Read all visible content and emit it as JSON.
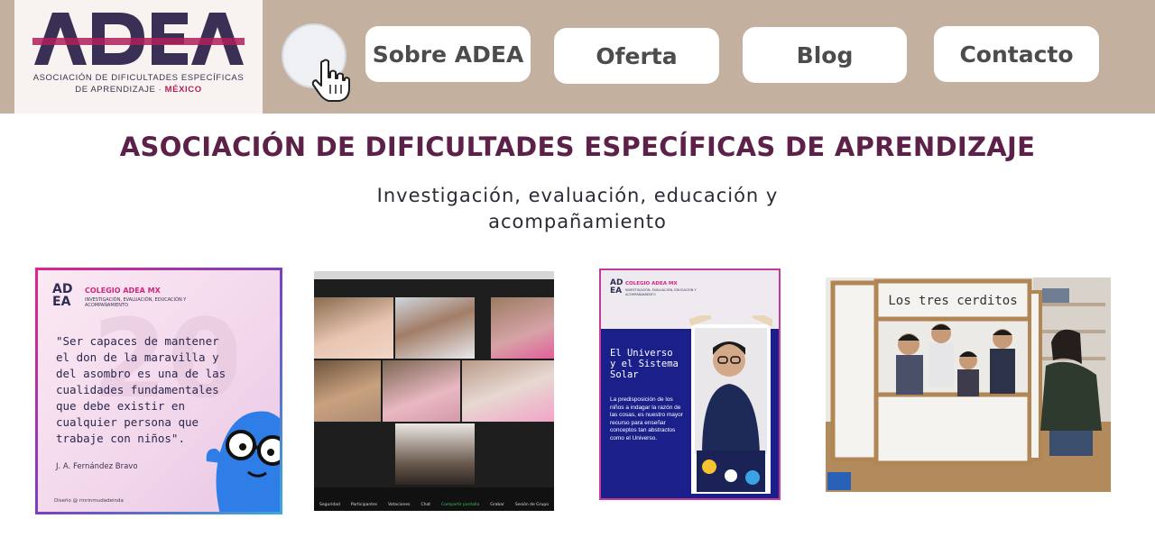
{
  "logo": {
    "wordmark": "ADEA",
    "subtitle_line1": "ASOCIACIÓN DE DIFICULTADES ESPECÍFICAS",
    "subtitle_line2": "DE APRENDIZAJE ·",
    "country": "MÉXICO"
  },
  "nav": {
    "items": [
      "Sobre ADEA",
      "Oferta",
      "Blog",
      "Contacto"
    ]
  },
  "hero": {
    "title": "ASOCIACIÓN DE DIFICULTADES ESPECÍFICAS DE APRENDIZAJE",
    "subtitle_line1": "Investigación, evaluación, educación y",
    "subtitle_line2": "acompañamiento"
  },
  "cards": [
    {
      "logo": "AD\nEA",
      "brand": "COLEGIO ADEA MX",
      "brand_sub": "INVESTIGACIÓN, EVALUACIÓN, EDUCACIÓN Y ACOMPAÑAMIENTO",
      "quote": "\"Ser capaces de mantener el don de la maravilla y del asombro es una de las cualidades fundamentales que debe existir en cualquier persona que trabaje con niños\".",
      "author": "J. A. Fernández Bravo",
      "credit": "Diseño @ rinrinmudadeinda"
    },
    {
      "toolbar": [
        "Seguridad",
        "Participantes",
        "Votaciones",
        "Chat",
        "Compartir pantalla",
        "Grabar",
        "Sesión de Grupo"
      ]
    },
    {
      "logo": "AD\nEA",
      "brand": "COLEGIO ADEA MX",
      "brand_sub": "INVESTIGACIÓN, EVALUACIÓN, EDUCACIÓN Y ACOMPAÑAMIENTO",
      "title": "El Universo y el Sistema Solar",
      "text": "La predisposición de los niños a indagar la razón de las cosas, es nuestro mayor recurso para enseñar conceptos tan abstractos como el Universo."
    },
    {
      "sign": "Los tres cerditos"
    }
  ],
  "colors": {
    "header_bg": "#c4b09f",
    "logo_bg": "#f8f3f1",
    "title_color": "#5c2049",
    "brand_pink": "#b01f5a",
    "logo_navy": "#3a2f55"
  }
}
